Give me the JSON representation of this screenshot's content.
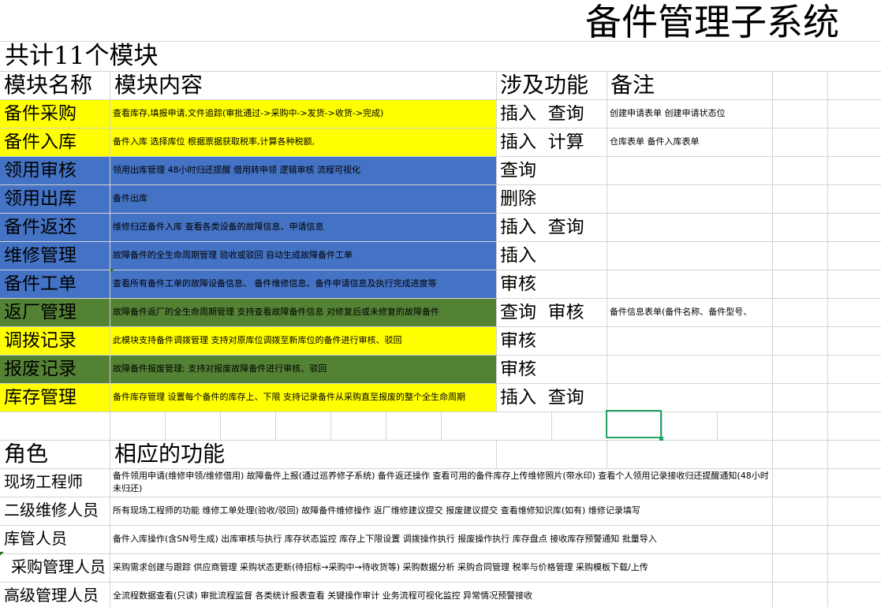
{
  "title": "备件管理子系统",
  "total": "共计11个模块",
  "headers": {
    "name": "模块名称",
    "content": "模块内容",
    "func": "涉及功能",
    "note": "备注"
  },
  "modules": [
    {
      "name": "备件采购",
      "content": "查看库存,填报申请,文件追踪(审批通过->采购中->发货->收货->完成)",
      "func": "插入  查询",
      "note": "创建申请表单 创建申请状态位",
      "color": "#ffff00"
    },
    {
      "name": "备件入库",
      "content": "备件入库 选择库位 根据票据获取税率,计算各种税额,",
      "func": "插入  计算",
      "note": "仓库表单 备件入库表单",
      "color": "#ffff00"
    },
    {
      "name": "领用审核",
      "content": "领用出库管理 48小时归还提醒 借用转申领 逻辑审核 流程可视化",
      "func": "查询",
      "note": "",
      "color": "#4472c4"
    },
    {
      "name": "领用出库",
      "content": "备件出库",
      "func": "删除",
      "note": "",
      "color": "#4472c4"
    },
    {
      "name": "备件返还",
      "content": "维修归还备件入库   查看各类设备的故障信息、申请信息",
      "func": "插入  查询",
      "note": "",
      "color": "#4472c4"
    },
    {
      "name": "维修管理",
      "content": "故障备件的全生命周期管理 验收或驳回 自动生成故障备件工单",
      "func": "插入",
      "note": "",
      "color": "#4472c4"
    },
    {
      "name": "备件工单",
      "content": "查看所有备件工单的故障设备信息、 备件维修信息、备件申请信息及执行完成进度等",
      "func": "审核",
      "note": "",
      "color": "#4472c4"
    },
    {
      "name": "返厂管理",
      "content": "故障备件返厂的全生命周期管理 支持查看故障备件信息 对修复后或未修复的故障备件",
      "func": "查询  审核",
      "note": "备件信息表单(备件名称、备件型号、",
      "color": "#548235"
    },
    {
      "name": "调拨记录",
      "content": "此模块支持备件调拨管理   支持对原库位调拨至新库位的备件进行审核、驳回",
      "func": "审核",
      "note": "",
      "color": "#ffff00"
    },
    {
      "name": "报废记录",
      "content": "故障备件报废管理;  支持对报废故障备件进行审核、驳回",
      "func": "审核",
      "note": "",
      "color": "#548235"
    },
    {
      "name": "库存管理",
      "content": "备件库存管理 设置每个备件的库存上、下限 支持记录备件从采购直至报废的整个全生命周期",
      "func": "插入  查询",
      "note": "",
      "color": "#ffff00"
    }
  ],
  "role_headers": {
    "role": "角色",
    "func": "相应的功能"
  },
  "roles": [
    {
      "name": "现场工程师",
      "func": "备件领用申请(维修申领/维修借用) 故障备件上报(通过巡养修子系统) 备件返还操作 查看可用的备件库存上传维修照片(带水印) 查看个人领用记录接收归还提醒通知(48小时未归还)"
    },
    {
      "name": "二级维修人员",
      "func": "所有现场工程师的功能 维修工单处理(验收/驳回) 故障备件维修操作 返厂维修建议提交 报废建议提交 查看维修知识库(如有) 维修记录填写"
    },
    {
      "name": "库管人员",
      "func": "备件入库操作(含SN号生成) 出库审核与执行 库存状态监控 库存上下限设置 调拨操作执行 报废操作执行 库存盘点 接收库存预警通知 批量导入"
    },
    {
      "name": "采购管理人员",
      "func": "采购需求创建与跟踪 供应商管理 采购状态更新(待招标→采购中→待收货等) 采购数据分析 采购合同管理 税率与价格管理 采购模板下载/上传"
    },
    {
      "name": "高级管理人员",
      "func": "全流程数据查看(只读) 审批流程监督 各类统计报表查看 关键操作审计 业务流程可视化监控 异常情况预警接收"
    }
  ]
}
